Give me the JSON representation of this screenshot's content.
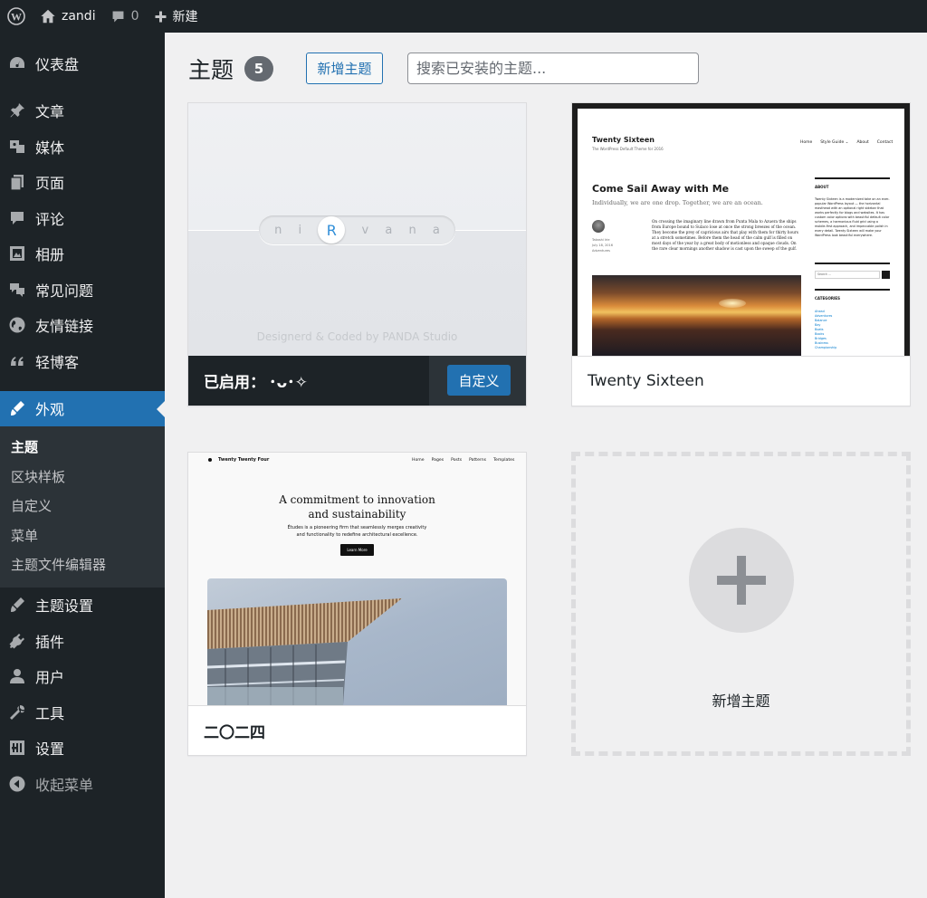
{
  "admin_bar": {
    "site_name": "zandi",
    "comments_count": "0",
    "new_label": "新建"
  },
  "sidebar": {
    "items": [
      {
        "label": "仪表盘",
        "icon": "dashboard-icon"
      },
      {
        "label": "文章",
        "icon": "pin-icon"
      },
      {
        "label": "媒体",
        "icon": "media-icon"
      },
      {
        "label": "页面",
        "icon": "page-icon"
      },
      {
        "label": "评论",
        "icon": "comment-icon"
      },
      {
        "label": "相册",
        "icon": "gallery-icon"
      },
      {
        "label": "常见问题",
        "icon": "faq-icon"
      },
      {
        "label": "友情链接",
        "icon": "globe-icon"
      },
      {
        "label": "轻博客",
        "icon": "quote-icon"
      },
      {
        "label": "外观",
        "icon": "brush-icon"
      },
      {
        "label": "主题设置",
        "icon": "brush-icon"
      },
      {
        "label": "插件",
        "icon": "plugin-icon"
      },
      {
        "label": "用户",
        "icon": "user-icon"
      },
      {
        "label": "工具",
        "icon": "wrench-icon"
      },
      {
        "label": "设置",
        "icon": "settings-icon"
      },
      {
        "label": "收起菜单",
        "icon": "collapse-icon"
      }
    ],
    "submenu": [
      "主题",
      "区块样板",
      "自定义",
      "菜单",
      "主题文件编辑器"
    ]
  },
  "page": {
    "title": "主题",
    "count": "5",
    "add_new": "新增主题",
    "search_placeholder": "搜索已安装的主题..."
  },
  "themes": {
    "active": {
      "prefix": "已启用：",
      "name": "･ᴗ･✧",
      "customize": "自定义",
      "shot": {
        "letters": [
          "n",
          "i",
          "R",
          "v",
          "a",
          "n",
          "a"
        ],
        "credit": "Designerd & Coded by PANDA Studio"
      }
    },
    "sixteen": {
      "name": "Twenty Sixteen",
      "shot": {
        "site_title": "Twenty Sixteen",
        "tagline": "The WordPress Default Theme for 2016",
        "nav": [
          "Home",
          "Style Guide ⌄",
          "About",
          "Contact"
        ],
        "post_title": "Come Sail Away with Me",
        "excerpt": "Individually, we are one drop. Together, we are an ocean.",
        "meta": [
          "Takashi Irie",
          "July 18, 2016",
          "Adventures"
        ],
        "paragraph": "On crossing the imaginary line drawn from Punta Mala to Azuera the ships from Europe bound to Sulaco lose at once the strong breezes of the ocean. They become the prey of capricious airs that play with them for thirty hours at a stretch sometimes. Before them the head of the calm gulf is filled on most days of the year by a great body of motionless and opaque clouds. On the rare clear mornings another shadow is cast upon the sweep of the gulf.",
        "about_heading": "ABOUT",
        "about_text": "Twenty Sixteen is a modernized take on an ever-popular WordPress layout — the horizontal masthead with an optional right sidebar that works perfectly for blogs and websites. It has custom color options with beautiful default color schemes, a harmonious fluid grid using a mobile-first approach, and impeccable polish in every detail. Twenty Sixteen will make your WordPress look beautiful everywhere.",
        "search_placeholder": "Search ...",
        "categories_heading": "CATEGORIES",
        "categories": [
          "Ahead",
          "Adventures",
          "Balance",
          "Bay",
          "Boats",
          "Books",
          "Bridges",
          "Business",
          "Championship"
        ]
      }
    },
    "tt4": {
      "name": "二〇二四",
      "shot": {
        "brand": "Twenty Twenty Four",
        "nav": [
          "Home",
          "Pages",
          "Posts",
          "Patterns",
          "Templates"
        ],
        "heading_line1": "A commitment to innovation",
        "heading_line2": "and sustainability",
        "sub_line1": "Études is a pioneering firm that seamlessly merges creativity",
        "sub_line2": "and functionality to redefine architectural excellence.",
        "button": "Learn More"
      }
    },
    "add_new_label": "新增主题"
  },
  "colors": {
    "admin_dark": "#1d2327",
    "accent": "#2271b1",
    "background": "#f0f0f1"
  }
}
